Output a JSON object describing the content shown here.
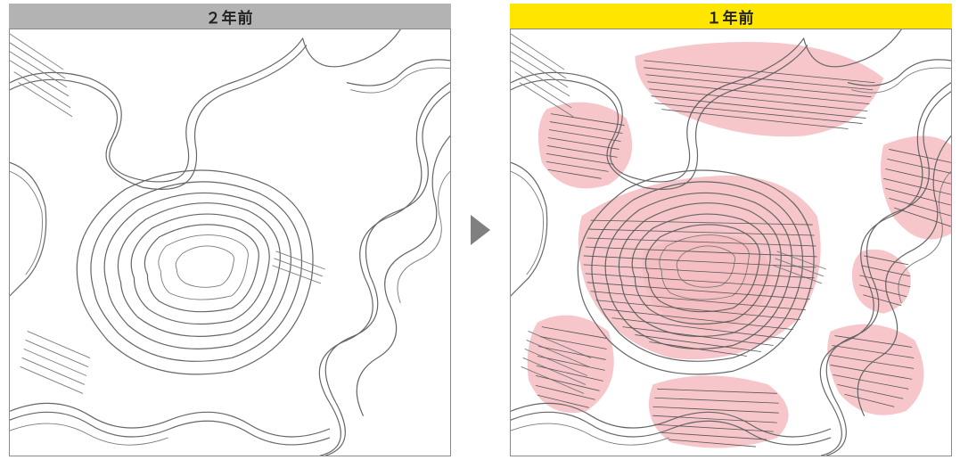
{
  "panels": {
    "left": {
      "title": "２年前",
      "header_color": "gray",
      "description": "contour map 2 years ago"
    },
    "right": {
      "title": "１年前",
      "header_color": "yellow",
      "description": "contour map 1 year ago with change overlay",
      "overlay_color": "#f5bcc1"
    }
  },
  "arrow_color": "#808080"
}
